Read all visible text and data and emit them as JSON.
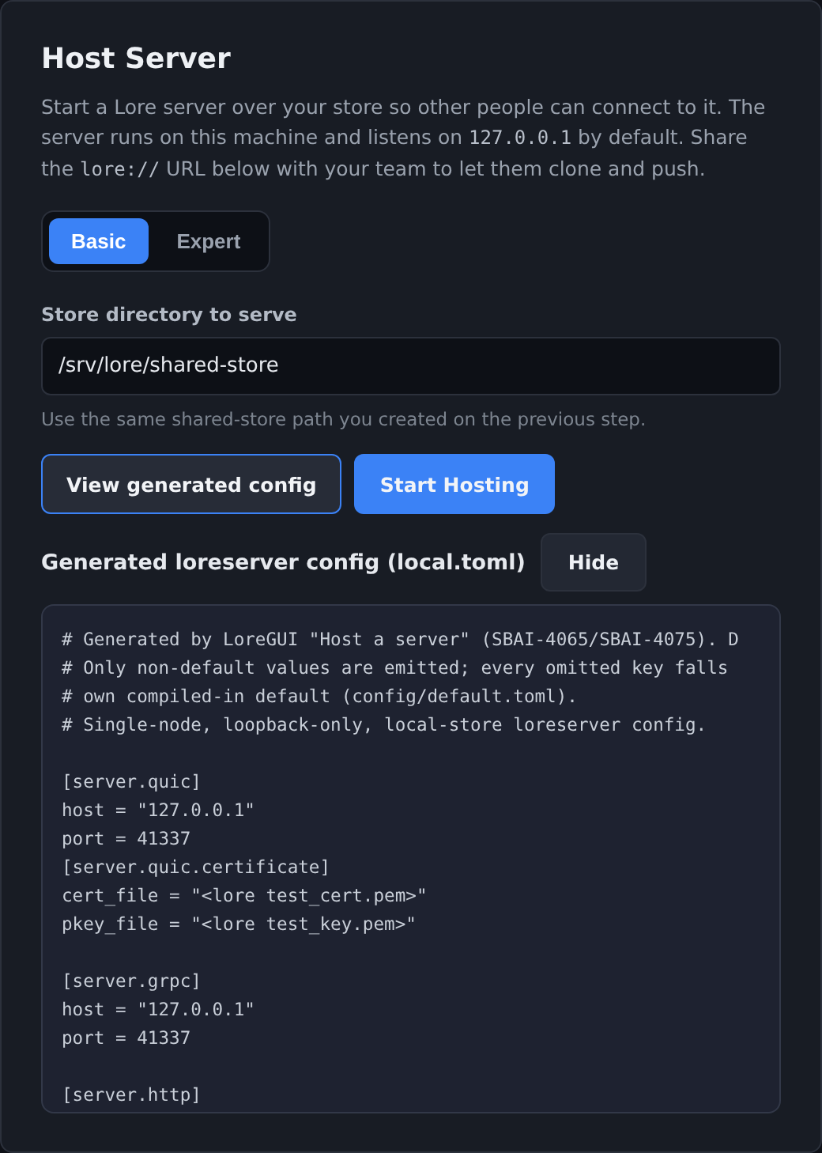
{
  "title": "Host Server",
  "description": [
    {
      "kind": "text",
      "text": "Start a Lore server over your store so other people can connect to it. The server runs on this machine and listens on "
    },
    {
      "kind": "code",
      "text": "127.0.0.1"
    },
    {
      "kind": "text",
      "text": " by default. Share the "
    },
    {
      "kind": "code",
      "text": "lore://"
    },
    {
      "kind": "text",
      "text": " URL below with your team to let them clone and push."
    }
  ],
  "mode_tabs": [
    {
      "label": "Basic",
      "selected": true
    },
    {
      "label": "Expert",
      "selected": false
    }
  ],
  "store_directory": {
    "label": "Store directory to serve",
    "value": "/srv/lore/shared-store",
    "hint": "Use the same shared-store path you created on the previous step."
  },
  "buttons": [
    {
      "label": "View generated config",
      "kind": "secondary"
    },
    {
      "label": "Start Hosting",
      "kind": "primary"
    }
  ],
  "config": {
    "title": "Generated loreserver config (local.toml)",
    "toggle": "Hide",
    "blocks": [
      [
        "# Generated by LoreGUI \"Host a server\" (SBAI-4065/SBAI-4075). D",
        "# Only non-default values are emitted; every omitted key falls",
        "# own compiled-in default (config/default.toml).",
        "# Single-node, loopback-only, local-store loreserver config."
      ],
      [
        "[server.quic]",
        "host = \"127.0.0.1\"",
        "port = 41337",
        "[server.quic.certificate]",
        "cert_file = \"<lore test_cert.pem>\"",
        "pkey_file = \"<lore test_key.pem>\""
      ],
      [
        "[server.grpc]",
        "host = \"127.0.0.1\"",
        "port = 41337"
      ],
      [
        "[server.http]"
      ]
    ]
  }
}
